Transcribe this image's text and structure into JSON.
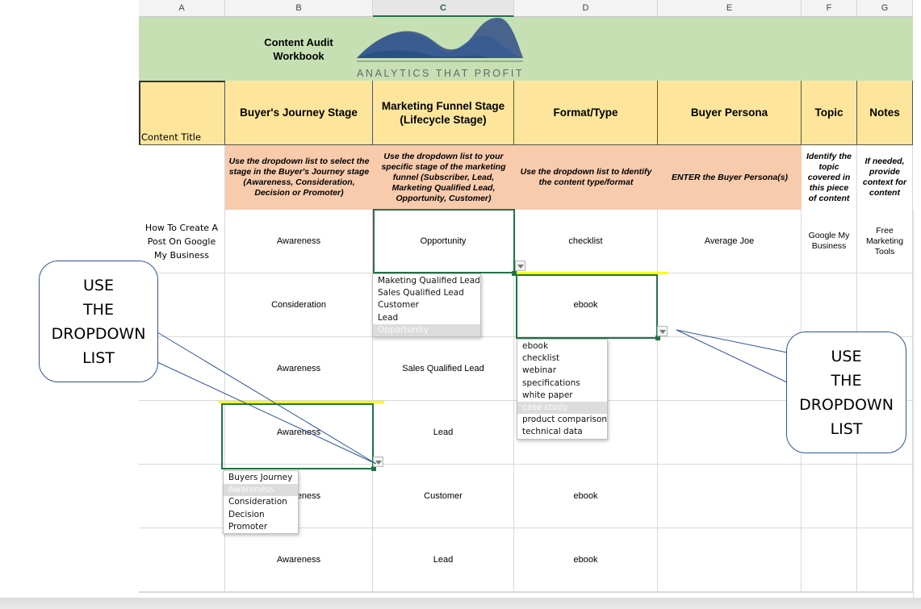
{
  "columns": [
    {
      "letter": "A",
      "selected": false
    },
    {
      "letter": "B",
      "selected": false
    },
    {
      "letter": "C",
      "selected": true
    },
    {
      "letter": "D",
      "selected": false
    },
    {
      "letter": "E",
      "selected": false
    },
    {
      "letter": "F",
      "selected": false
    },
    {
      "letter": "G",
      "selected": false
    }
  ],
  "banner": {
    "title_line1": "Content Audit",
    "title_line2": "Workbook",
    "logo_text": "ANALYTICS THAT PROFIT",
    "background": "#c6e0b4"
  },
  "headers": {
    "content_title": "Content Title",
    "buyers_journey": "Buyer's Journey Stage",
    "marketing_funnel": "Marketing Funnel Stage (Lifecycle Stage)",
    "format_type": "Format/Type",
    "buyer_persona": "Buyer Persona",
    "topic": "Topic",
    "notes": "Notes"
  },
  "instructions": {
    "buyers_journey": "Use the dropdown list to select the stage in the Buyer's Journey stage (Awareness, Consideration, Decision or Promoter)",
    "marketing_funnel": "Use the dropdown list to your specific stage of the marketing funnel (Subscriber, Lead, Marketing Qualified Lead, Opportunity, Customer)",
    "format_type": "Use the dropdown list to Identify the content type/format",
    "buyer_persona": "ENTER the Buyer Persona(s)",
    "topic": "Identify the topic covered in this piece of content",
    "notes": "If needed, provide context for content"
  },
  "rows": [
    {
      "title": "How To Create A Post On Google My Business",
      "journey": "Awareness",
      "funnel": "Opportunity",
      "format": "checklist",
      "persona": "Average Joe",
      "topic": "Google My Business",
      "notes": "Free Marketing Tools"
    },
    {
      "title": "",
      "journey": "Consideration",
      "funnel": "",
      "format": "ebook",
      "persona": "",
      "topic": "",
      "notes": ""
    },
    {
      "title": "",
      "journey": "Awareness",
      "funnel": "Sales Qualified Lead",
      "format": "",
      "persona": "",
      "topic": "",
      "notes": ""
    },
    {
      "title": "",
      "journey": "Awareness",
      "funnel": "Lead",
      "format": "",
      "persona": "",
      "topic": "",
      "notes": ""
    },
    {
      "title": "",
      "journey": "Awareness",
      "funnel": "Customer",
      "format": "ebook",
      "persona": "",
      "topic": "",
      "notes": ""
    },
    {
      "title": "",
      "journey": "Awareness",
      "funnel": "Lead",
      "format": "ebook",
      "persona": "",
      "topic": "",
      "notes": ""
    }
  ],
  "dropdowns": {
    "funnel": {
      "options": [
        "Maketing Qualified Lead",
        "Sales Qualified Lead",
        "Customer",
        "Lead",
        "Opportunity"
      ],
      "highlighted": "Opportunity"
    },
    "format": {
      "options": [
        "ebook",
        "checklist",
        "webinar",
        "specifications",
        "white paper",
        "case study",
        "product comparison",
        "technical data"
      ],
      "highlighted": "case study"
    },
    "journey": {
      "options": [
        "Buyers Journey",
        "Awareness",
        "Consideration",
        "Decision",
        "Promoter"
      ],
      "highlighted": "Awareness"
    }
  },
  "callouts": {
    "left": {
      "line1": "USE",
      "line2": "THE",
      "line3": "DROPDOWN",
      "line4": "LIST"
    },
    "right": {
      "line1": "USE",
      "line2": "THE",
      "line3": "DROPDOWN",
      "line4": "LIST"
    }
  },
  "colors": {
    "header_yellow": "#fde69c",
    "instruction_peach": "#f8cbad",
    "selection_green": "#217346",
    "callout_blue": "#2f5597",
    "highlight_yellow": "#ffff00"
  }
}
